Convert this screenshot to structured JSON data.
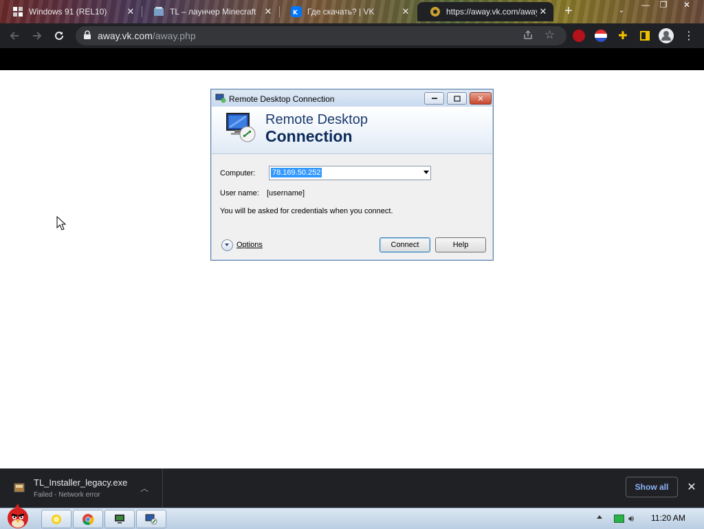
{
  "browser": {
    "tabs": [
      {
        "title": "Windows 91 (REL10)"
      },
      {
        "title": "TL – лаунчер Minecraft"
      },
      {
        "title": "Где скачать? | VK"
      },
      {
        "title": "https://away.vk.com/away.php"
      }
    ],
    "address": {
      "host": "away.vk.com",
      "path": "/away.php"
    }
  },
  "dialog": {
    "window_title": "Remote Desktop Connection",
    "heading_line1": "Remote Desktop",
    "heading_line2": "Connection",
    "computer_label": "Computer:",
    "computer_value": "78.169.50.252",
    "username_label": "User name:",
    "username_value": "[username]",
    "credentials_note": "You will be asked for credentials when you connect.",
    "options_label": "Options",
    "connect_label": "Connect",
    "help_label": "Help"
  },
  "downloads": {
    "file_name": "TL_Installer_legacy.exe",
    "status": "Failed - Network error",
    "show_all_label": "Show all"
  },
  "taskbar": {
    "clock": "11:20 AM"
  },
  "colors": {
    "browser_dark": "#202124",
    "link_blue": "#8ab4f8",
    "selection_blue": "#3399ff",
    "rdp_title_blue": "#0b2a5a"
  }
}
